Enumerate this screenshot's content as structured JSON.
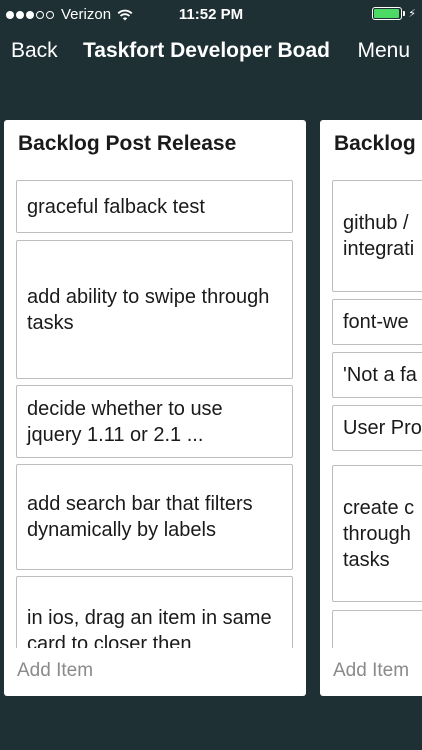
{
  "status_bar": {
    "carrier": "Verizon",
    "time": "11:52 PM",
    "signal_bars_filled": 3,
    "signal_bars_total": 5,
    "battery_level": 0.95,
    "icons": [
      "wifi-icon",
      "battery-icon",
      "charging-bolt-icon"
    ]
  },
  "nav": {
    "back_label": "Back",
    "title": "Taskfort Developer Boad",
    "menu_label": "Menu"
  },
  "columns": [
    {
      "title": "Backlog Post Release",
      "tasks": [
        "graceful falback test",
        "add ability to swipe through tasks",
        "decide whether to use jquery 1.11 or 2.1 ...",
        "add search bar that filters dynamically by labels",
        "in ios, drag an item in same card to closer then"
      ],
      "add_item_label": "Add Item"
    },
    {
      "title": "Backlog",
      "tasks": [
        "github / integrati",
        "font-we",
        "'Not a fa",
        "User Pro",
        "create c through tasks",
        ""
      ],
      "add_item_label": "Add Item"
    }
  ],
  "colors": {
    "background": "#1f3034",
    "card": "#ffffff",
    "task_border": "#bdbdbd",
    "add_item_text": "#8a8a8a",
    "battery_fill": "#4cd964"
  }
}
